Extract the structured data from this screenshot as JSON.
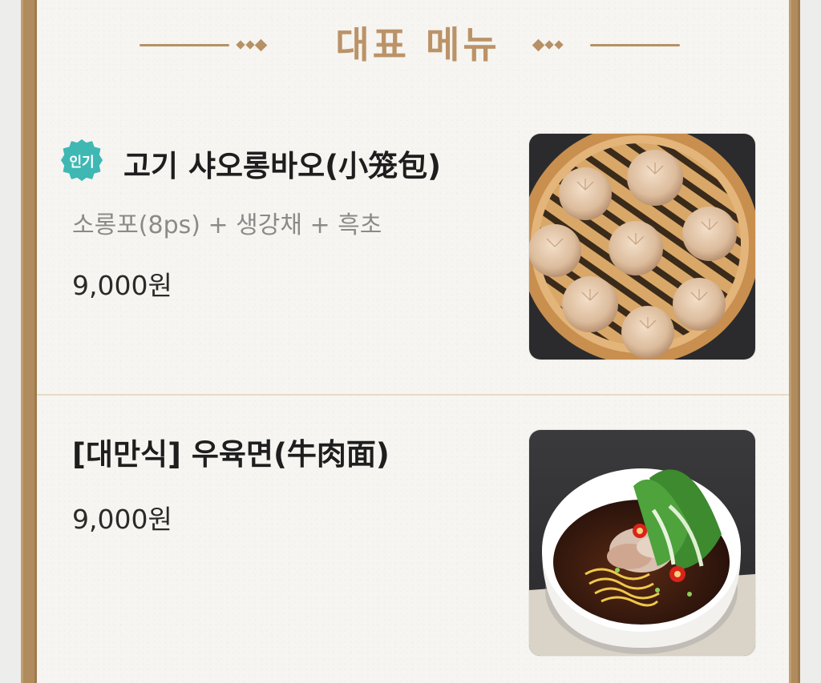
{
  "header": {
    "title": "대표 메뉴"
  },
  "menu": [
    {
      "badge": "인기",
      "title": "고기 샤오롱바오(小笼包)",
      "description": "소롱포(8ps) + 생강채 + 흑초",
      "price": "9,000원",
      "image": "steamed-dumplings-photo"
    },
    {
      "title": "[대만식] 우육면(牛肉面)",
      "price": "9,000원",
      "image": "beef-noodle-soup-photo"
    }
  ],
  "colors": {
    "accent_gold": "#b08b5d",
    "header_text": "#bb9368",
    "badge_teal": "#3fb8b4"
  }
}
